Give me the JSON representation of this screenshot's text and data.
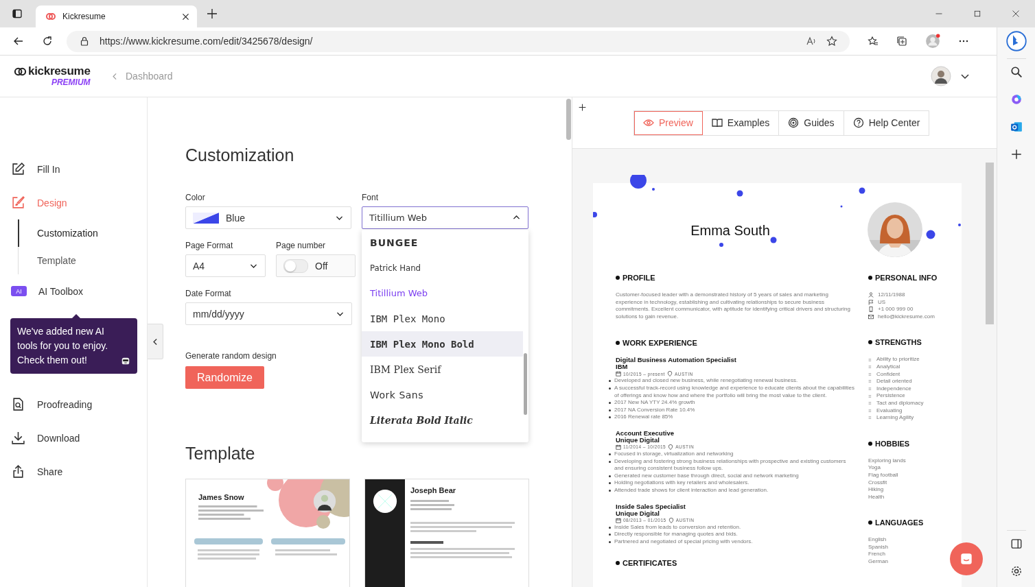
{
  "browser": {
    "tab_title": "Kickresume",
    "url": "https://www.kickresume.com/edit/3425678/design/"
  },
  "header": {
    "logo": "kickresume",
    "badge": "PREMIUM",
    "breadcrumb": "Dashboard"
  },
  "sidebar": {
    "items": [
      {
        "label": "Fill In",
        "kind": "link",
        "selected": false
      },
      {
        "label": "Design",
        "kind": "link",
        "selected": true,
        "children": [
          {
            "label": "Customization",
            "selected": true
          },
          {
            "label": "Template",
            "selected": false
          }
        ]
      },
      {
        "label": "AI Toolbox",
        "kind": "ai",
        "badge": "AI",
        "selected": false
      },
      {
        "label": "Proofreading",
        "kind": "link",
        "selected": false
      },
      {
        "label": "Download",
        "kind": "link",
        "selected": false
      },
      {
        "label": "Share",
        "kind": "link",
        "selected": false
      }
    ],
    "tooltip": "We've added new AI tools for you to enjoy. Check them out!"
  },
  "customization": {
    "title": "Customization",
    "color": {
      "label": "Color",
      "value": "Blue"
    },
    "font": {
      "label": "Font",
      "value": "Titillium Web",
      "expanded": true,
      "options": [
        {
          "label": "BUNGEE",
          "kind": "display",
          "selected": false,
          "hovered": false
        },
        {
          "label": "Patrick Hand",
          "kind": "hand",
          "selected": false,
          "hovered": false
        },
        {
          "label": "Titillium Web",
          "kind": "sans",
          "selected": true,
          "hovered": false
        },
        {
          "label": "IBM Plex Mono",
          "kind": "mono",
          "selected": false,
          "hovered": false
        },
        {
          "label": "IBM Plex Mono Bold",
          "kind": "mono-bold",
          "selected": false,
          "hovered": true
        },
        {
          "label": "IBM Plex Serif",
          "kind": "serif",
          "selected": false,
          "hovered": false
        },
        {
          "label": "Work Sans",
          "kind": "sans-wide",
          "selected": false,
          "hovered": false
        },
        {
          "label": "Literata Bold Italic",
          "kind": "serif-bold-italic",
          "selected": false,
          "hovered": false
        }
      ]
    },
    "page_format": {
      "label": "Page Format",
      "value": "A4"
    },
    "page_number": {
      "label": "Page number",
      "on": false,
      "value": "Off"
    },
    "date_format": {
      "label": "Date Format",
      "value": "mm/dd/yyyy"
    },
    "random": {
      "label": "Generate random design",
      "button": "Randomize"
    }
  },
  "template": {
    "title": "Template",
    "cards": [
      {
        "name": "James Snow",
        "kind": "light"
      },
      {
        "name": "Joseph Bear",
        "kind": "dark"
      }
    ]
  },
  "preview": {
    "buttons": [
      {
        "label": "Preview",
        "selected": true
      },
      {
        "label": "Examples",
        "selected": false
      },
      {
        "label": "Guides",
        "selected": false
      },
      {
        "label": "Help Center",
        "selected": false
      }
    ]
  },
  "resume": {
    "name": "Emma South",
    "profile": {
      "heading": "PROFILE",
      "text": "Customer-focused leader with a demonstrated history of 5 years of sales and marketing experience in technology, establishing and cultivating relationships to secure business commitments. Excellent communicator, with aptitude for identifying critical drivers and structuring solutions to gain revenue."
    },
    "work": {
      "heading": "WORK EXPERIENCE",
      "jobs": [
        {
          "title": "Digital Business Automation Specialist",
          "company": "IBM",
          "dates": "10/2015 – present",
          "location": "AUSTIN",
          "bullets": [
            "Developed and closed new business, while renegotiating renewal business.",
            "A successful track-record using knowledge and experience  to educate clients about the capabilities of offerings and know how and where the portfolio will bring the most value to the client.",
            "2017 New NA YTY 24.4% growth",
            "2017 NA Conversion Rate 10.4%",
            "2016 Renewal rate 85%"
          ]
        },
        {
          "title": "Account Executive",
          "company": "Unique Digital",
          "dates": "11/2014 – 10/2015",
          "location": "AUSTIN",
          "bullets": [
            "Focused in storage, virtualization and networking",
            "Developing and fostering strong business relationships with prospective and existing customers and ensuring consistent business follow ups.",
            "Generated new customer base through direct, social and network marketing",
            "Holding negotiations with key retailers and wholesalers.",
            "Attended trade shows for client interaction and lead generation."
          ]
        },
        {
          "title": "Inside Sales Specialist",
          "company": "Unique Digital",
          "dates": "08/2013 – 01/2015",
          "location": "AUSTIN",
          "bullets": [
            "Inside Sales from leads to conversion and retention.",
            "Directly responsible for managing quotes and bids.",
            "Partnered and negotiated of special pricing with vendors."
          ]
        }
      ]
    },
    "certificates": {
      "heading": "CERTIFICATES"
    },
    "personal": {
      "heading": "PERSONAL INFO",
      "items": [
        {
          "kind": "birthday",
          "text": "12/11/1988"
        },
        {
          "kind": "country",
          "text": "US"
        },
        {
          "kind": "phone",
          "text": "+1 000 999 00"
        },
        {
          "kind": "email",
          "text": "hello@kickresume.com"
        }
      ]
    },
    "strengths": {
      "heading": "STRENGTHS",
      "items": [
        "Ability to prioritize",
        "Analytical",
        "Confident",
        "Detail oriented",
        "Independence",
        "Persistence",
        "Tact and diplomacy",
        "Evaluating",
        "Learning Agility"
      ]
    },
    "hobbies": {
      "heading": "HOBBIES",
      "items": [
        "Exploring lands",
        "Yoga",
        "Flag football",
        "Crossfit",
        "Hiking",
        "Health"
      ]
    },
    "languages": {
      "heading": "LANGUAGES",
      "items": [
        "English",
        "Spanish",
        "French",
        "German"
      ]
    }
  }
}
